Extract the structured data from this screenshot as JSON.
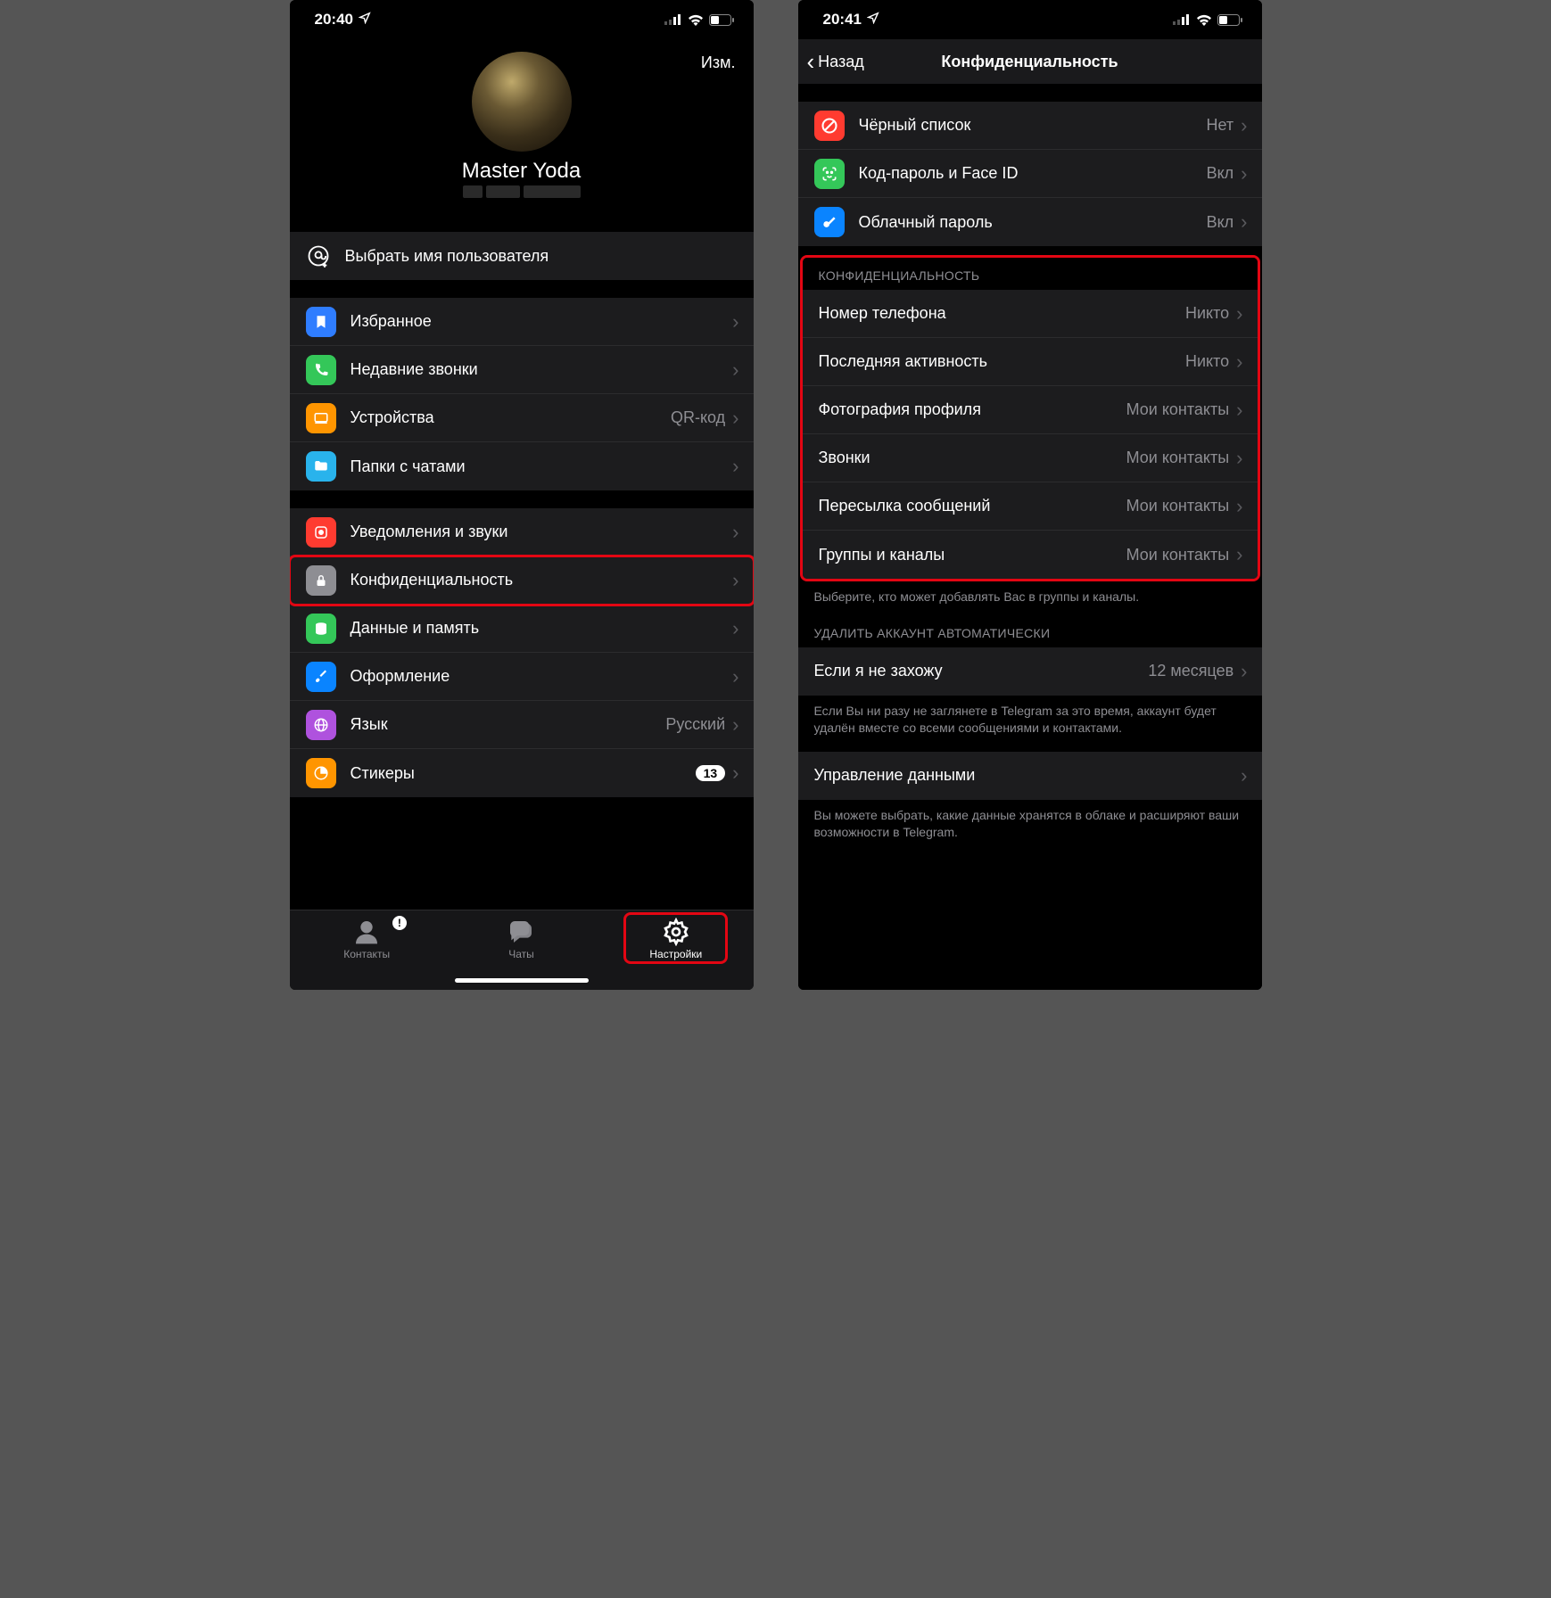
{
  "left": {
    "status_time": "20:40",
    "edit": "Изм.",
    "profile_name": "Master Yoda",
    "username_row": "Выбрать имя пользователя",
    "g1": [
      {
        "label": "Избранное",
        "value": "",
        "color": "#2f7dff"
      },
      {
        "label": "Недавние звонки",
        "value": "",
        "color": "#34c759"
      },
      {
        "label": "Устройства",
        "value": "QR-код",
        "color": "#ff9500"
      },
      {
        "label": "Папки с чатами",
        "value": "",
        "color": "#29b3ec"
      }
    ],
    "g2": [
      {
        "label": "Уведомления и звуки",
        "value": "",
        "color": "#ff3b30"
      },
      {
        "label": "Конфиденциальность",
        "value": "",
        "color": "#8e8e93"
      },
      {
        "label": "Данные и память",
        "value": "",
        "color": "#34c759"
      },
      {
        "label": "Оформление",
        "value": "",
        "color": "#0a84ff"
      },
      {
        "label": "Язык",
        "value": "Русский",
        "color": "#af52de"
      },
      {
        "label": "Стикеры",
        "value": "",
        "badge": "13",
        "color": "#ff9500"
      }
    ],
    "tabs": {
      "contacts": "Контакты",
      "chats": "Чаты",
      "settings": "Настройки"
    }
  },
  "right": {
    "status_time": "20:41",
    "back": "Назад",
    "title": "Конфиденциальность",
    "g1": [
      {
        "label": "Чёрный список",
        "value": "Нет",
        "color": "#ff3b30"
      },
      {
        "label": "Код-пароль и Face ID",
        "value": "Вкл",
        "color": "#34c759"
      },
      {
        "label": "Облачный пароль",
        "value": "Вкл",
        "color": "#0a84ff"
      }
    ],
    "privacy_header": "КОНФИДЕНЦИАЛЬНОСТЬ",
    "g2": [
      {
        "label": "Номер телефона",
        "value": "Никто"
      },
      {
        "label": "Последняя активность",
        "value": "Никто"
      },
      {
        "label": "Фотография профиля",
        "value": "Мои контакты"
      },
      {
        "label": "Звонки",
        "value": "Мои контакты"
      },
      {
        "label": "Пересылка сообщений",
        "value": "Мои контакты"
      },
      {
        "label": "Группы и каналы",
        "value": "Мои контакты"
      }
    ],
    "g2_footer": "Выберите, кто может добавлять Вас в группы и каналы.",
    "delete_header": "УДАЛИТЬ АККАУНТ АВТОМАТИЧЕСКИ",
    "g3": [
      {
        "label": "Если я не захожу",
        "value": "12 месяцев"
      }
    ],
    "g3_footer": "Если Вы ни разу не заглянете в Telegram за это время, аккаунт будет удалён вместе со всеми сообщениями и контактами.",
    "g4_label": "Управление данными",
    "g4_footer": "Вы можете выбрать, какие данные хранятся в облаке и расширяют ваши возможности в Telegram."
  }
}
